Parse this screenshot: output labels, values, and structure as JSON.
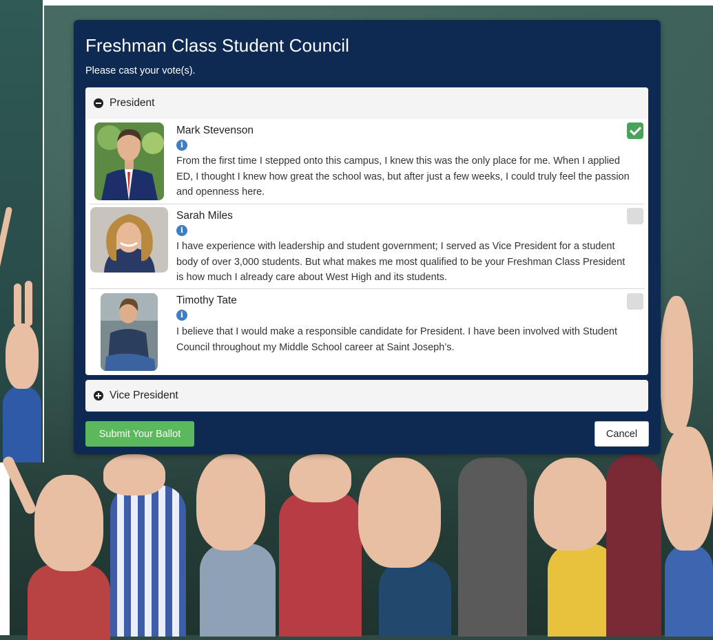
{
  "ballot": {
    "title": "Freshman Class Student Council",
    "instructions": "Please cast your vote(s)."
  },
  "sections": [
    {
      "label": "President",
      "icon": "minus-circle-icon",
      "expanded": true,
      "candidates": [
        {
          "name": "Mark Stevenson",
          "info_icon": "info-icon",
          "info_glyph": "i",
          "bio": "From the first time I stepped onto this campus, I knew this was the only place for me. When I applied ED, I thought I knew how great the school was, but after just a few weeks, I could truly feel the passion and openness here.",
          "selected": true
        },
        {
          "name": "Sarah Miles",
          "info_icon": "info-icon",
          "info_glyph": "i",
          "bio": "I have experience with leadership and student government; I served as Vice President for a student body of over 3,000 students. But what makes me most qualified to be your Freshman Class President is how much I already care about West High and its students.",
          "selected": false
        },
        {
          "name": "Timothy Tate",
          "info_icon": "info-icon",
          "info_glyph": "i",
          "bio": "I believe that I would make a responsible candidate for President. I have been involved with Student Council throughout my Middle School career at Saint Joseph’s.",
          "selected": false
        }
      ]
    },
    {
      "label": "Vice President",
      "icon": "plus-circle-icon",
      "expanded": false
    }
  ],
  "actions": {
    "submit_label": "Submit Your Ballot",
    "cancel_label": "Cancel"
  },
  "colors": {
    "panel_bg": "#0f2a52",
    "submit_bg": "#5cb85c",
    "checkbox_selected": "#4aa35a",
    "info_icon": "#3d7ec4"
  }
}
